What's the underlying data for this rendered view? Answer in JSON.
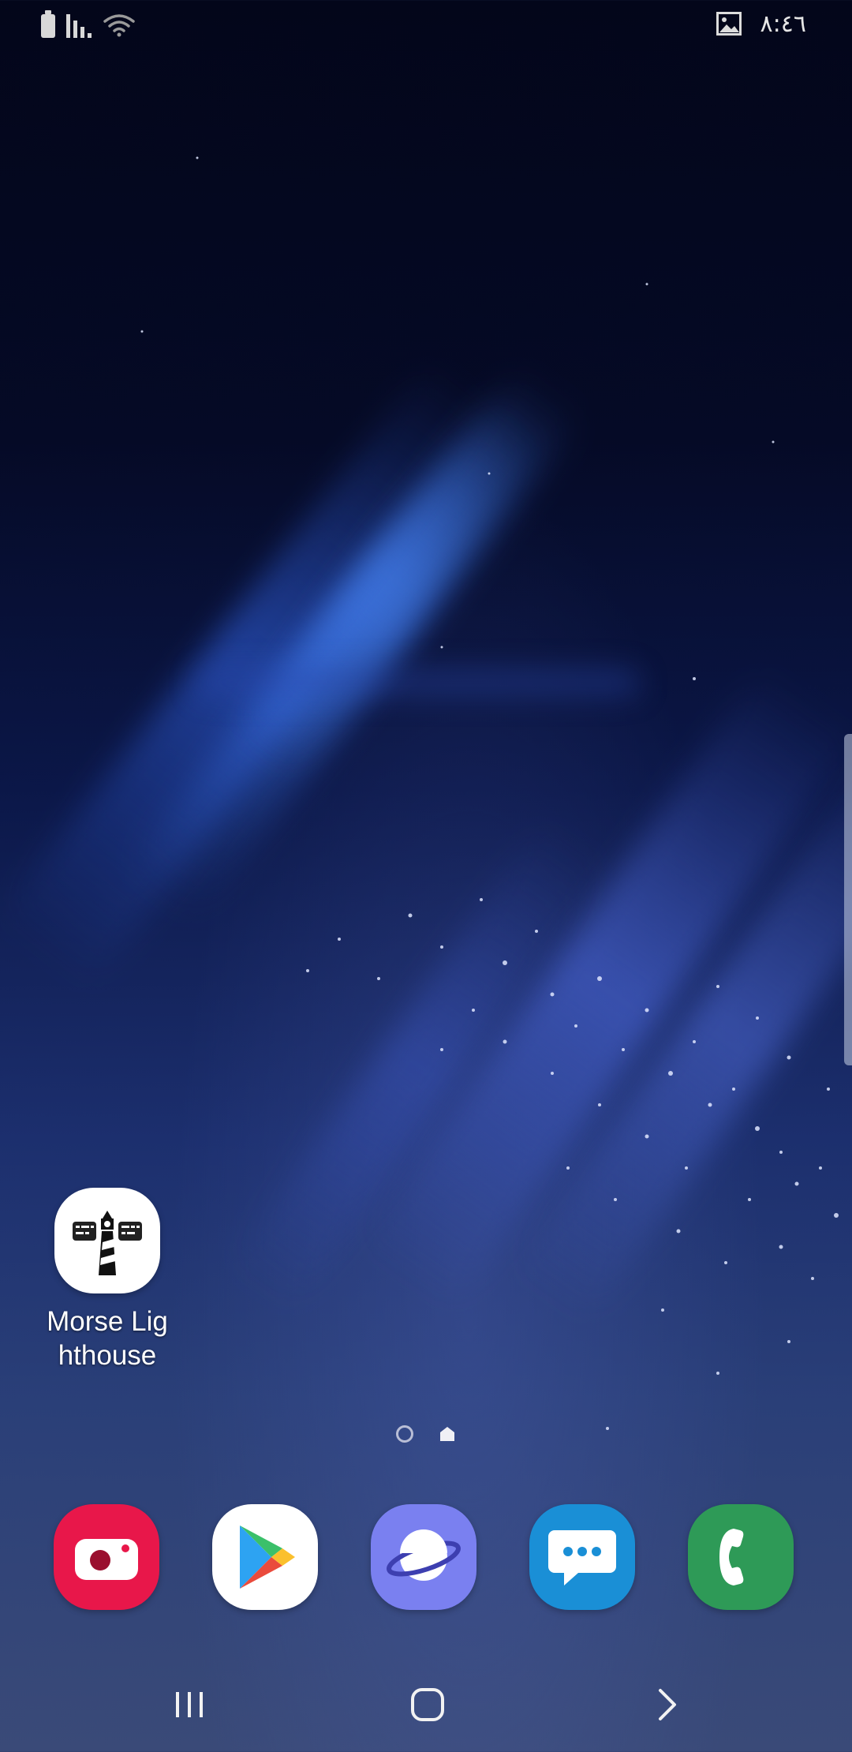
{
  "status_bar": {
    "clock": "٨:٤٦",
    "icons": [
      "battery-icon",
      "signal-icon",
      "wifi-icon",
      "gallery-notification-icon"
    ]
  },
  "home_apps": [
    {
      "label": "Morse Lig\nhthouse",
      "icon": "lighthouse-icon"
    }
  ],
  "page_indicator": {
    "pages": [
      "page-dot",
      "home-page-indicator"
    ],
    "current": 1
  },
  "dock": [
    {
      "name": "camera",
      "icon": "camera-icon",
      "color": "#e8174a"
    },
    {
      "name": "play-store",
      "icon": "play-store-icon",
      "color": "#ffffff"
    },
    {
      "name": "internet",
      "icon": "internet-browser-icon",
      "color": "#7a80f0"
    },
    {
      "name": "messages",
      "icon": "messages-icon",
      "color": "#1a8fd6"
    },
    {
      "name": "phone",
      "icon": "phone-icon",
      "color": "#2e9a57"
    }
  ],
  "navigation": [
    "recent-apps-icon",
    "home-icon",
    "forward-icon"
  ]
}
